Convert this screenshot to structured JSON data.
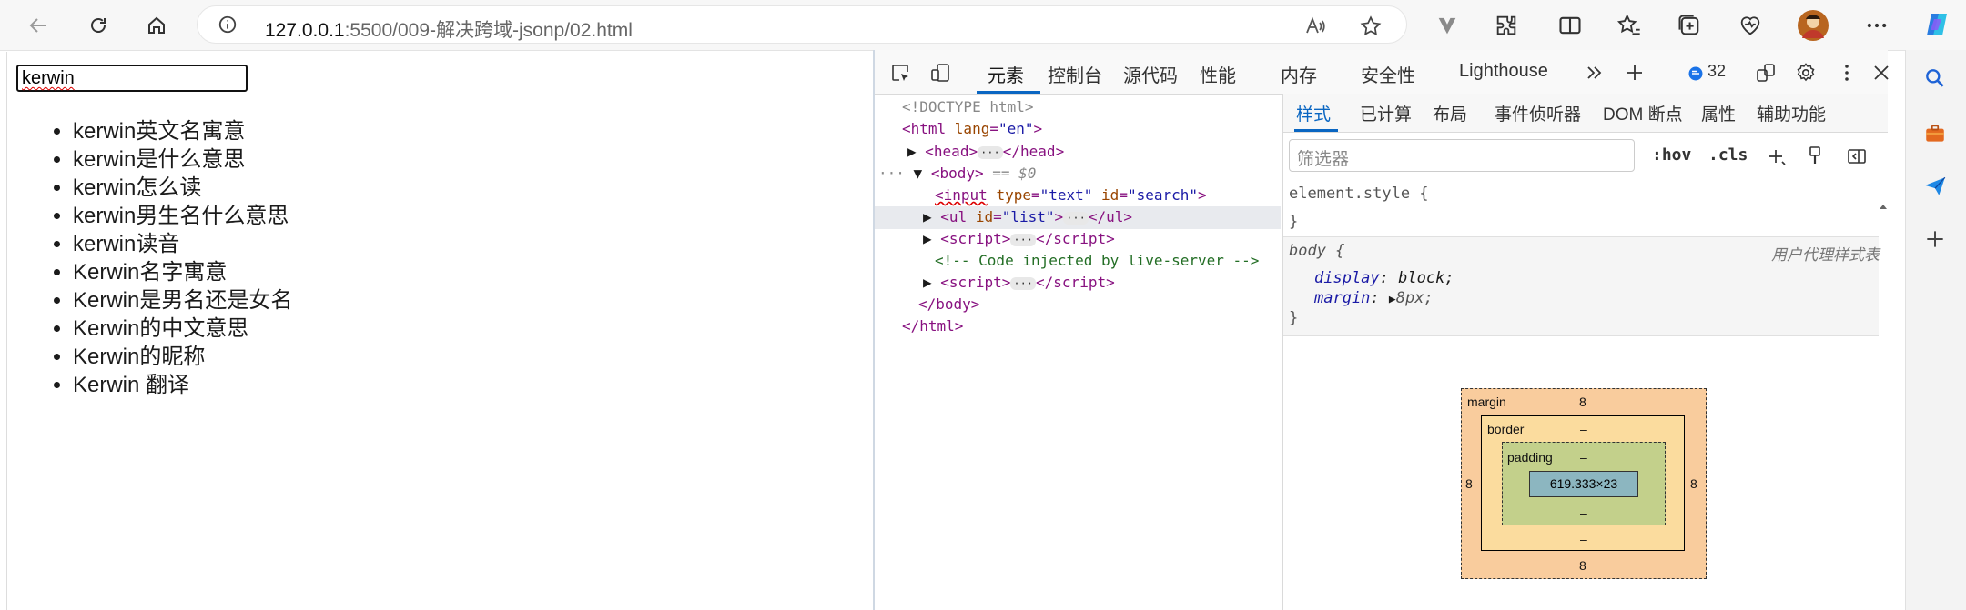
{
  "browser": {
    "url_host": "127.0.0.1",
    "url_path": ":5500/009-解决跨域-jsonp/02.html"
  },
  "page": {
    "search_value": "kerwin",
    "list_items": [
      "kerwin英文名寓意",
      "kerwin是什么意思",
      "kerwin怎么读",
      "kerwin男生名什么意思",
      "kerwin读音",
      "Kerwin名字寓意",
      "Kerwin是男名还是女名",
      "Kerwin的中文意思",
      "Kerwin的昵称",
      "Kerwin 翻译"
    ]
  },
  "devtools": {
    "tabs": [
      "元素",
      "控制台",
      "源代码",
      "性能",
      "内存",
      "安全性",
      "Lighthouse"
    ],
    "issues_count": "32",
    "styles_tabs": [
      "样式",
      "已计算",
      "布局",
      "事件侦听器",
      "DOM 断点",
      "属性",
      "辅助功能"
    ],
    "filter_placeholder": "筛选器",
    "hov": ":hov",
    "cls": ".cls",
    "element_style": "element.style {",
    "close_brace": "}",
    "body_selector": "body {",
    "ua_label": "用户代理样式表",
    "prop_display": "display",
    "val_display": "block;",
    "prop_margin": "margin",
    "val_margin": "8px;",
    "dom": {
      "doctype": "<!DOCTYPE html>",
      "sel_marker": "== $0",
      "comment": "<!-- Code injected by live-server -->"
    },
    "box_model": {
      "margin_label": "margin",
      "border_label": "border",
      "padding_label": "padding",
      "margin": "8",
      "border": "–",
      "padding": "–",
      "content": "619.333×23"
    }
  }
}
